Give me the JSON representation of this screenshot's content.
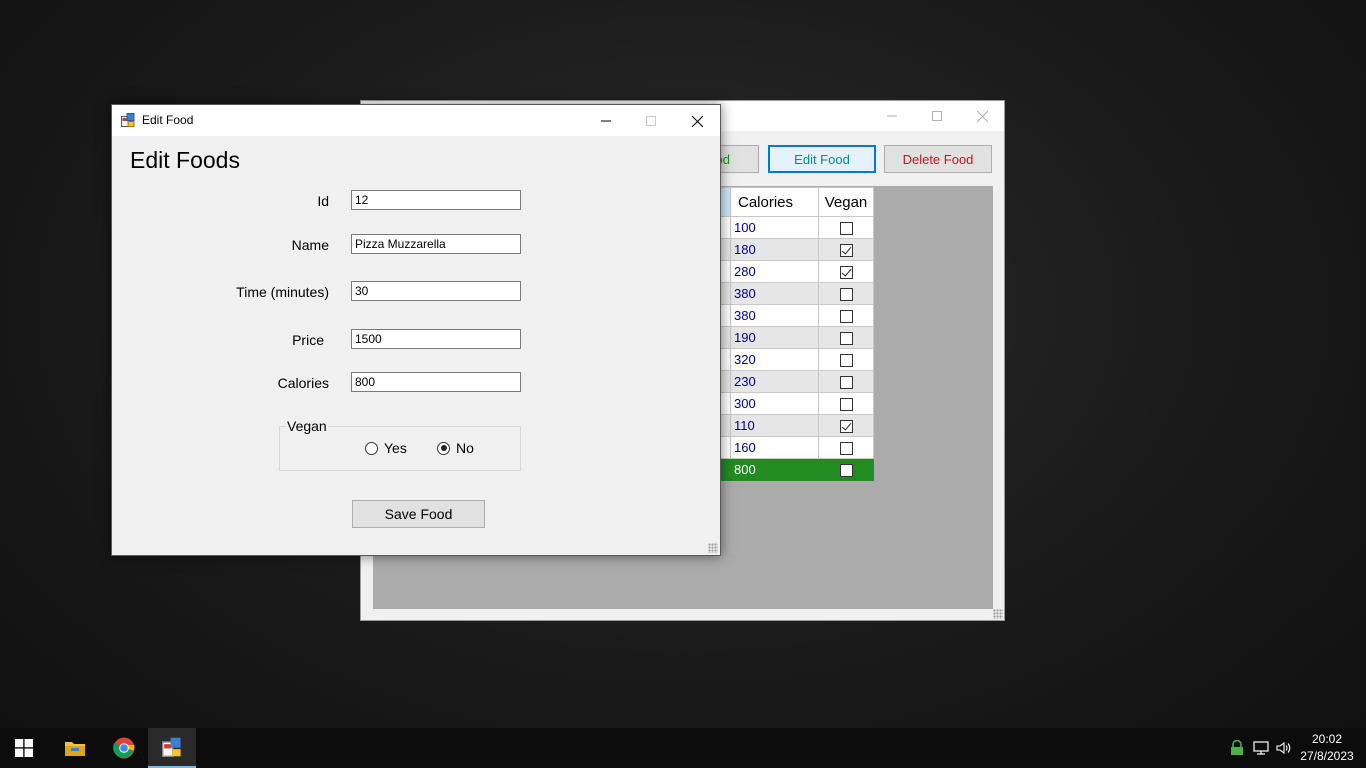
{
  "main_window": {
    "buttons": {
      "add_partial": "od",
      "edit": "Edit Food",
      "delete": "Delete Food"
    },
    "grid": {
      "columns": [
        "Calories",
        "Vegan"
      ],
      "rows": [
        {
          "calories": "100",
          "vegan": false
        },
        {
          "calories": "180",
          "vegan": true
        },
        {
          "calories": "280",
          "vegan": true
        },
        {
          "calories": "380",
          "vegan": false
        },
        {
          "calories": "380",
          "vegan": false
        },
        {
          "calories": "190",
          "vegan": false
        },
        {
          "calories": "320",
          "vegan": false
        },
        {
          "calories": "230",
          "vegan": false
        },
        {
          "calories": "300",
          "vegan": false
        },
        {
          "calories": "110",
          "vegan": true
        },
        {
          "calories": "160",
          "vegan": false
        },
        {
          "calories": "800",
          "vegan": false,
          "selected": true
        }
      ]
    }
  },
  "edit_window": {
    "title": "Edit Food",
    "heading": "Edit Foods",
    "fields": {
      "id": {
        "label": "Id",
        "value": "12"
      },
      "name": {
        "label": "Name",
        "value": "Pizza Muzzarella"
      },
      "time": {
        "label": "Time (minutes)",
        "value": "30"
      },
      "price": {
        "label": "Price",
        "value": "1500"
      },
      "calories": {
        "label": "Calories",
        "value": "800"
      }
    },
    "vegan_group": {
      "legend": "Vegan",
      "yes": "Yes",
      "no": "No",
      "selected": "No"
    },
    "save_button": "Save Food"
  },
  "taskbar": {
    "apps": [
      "start-icon",
      "file-explorer-icon",
      "chrome-icon",
      "winforms-app-icon"
    ],
    "clock": {
      "time": "20:02",
      "date": "27/8/2023"
    }
  }
}
